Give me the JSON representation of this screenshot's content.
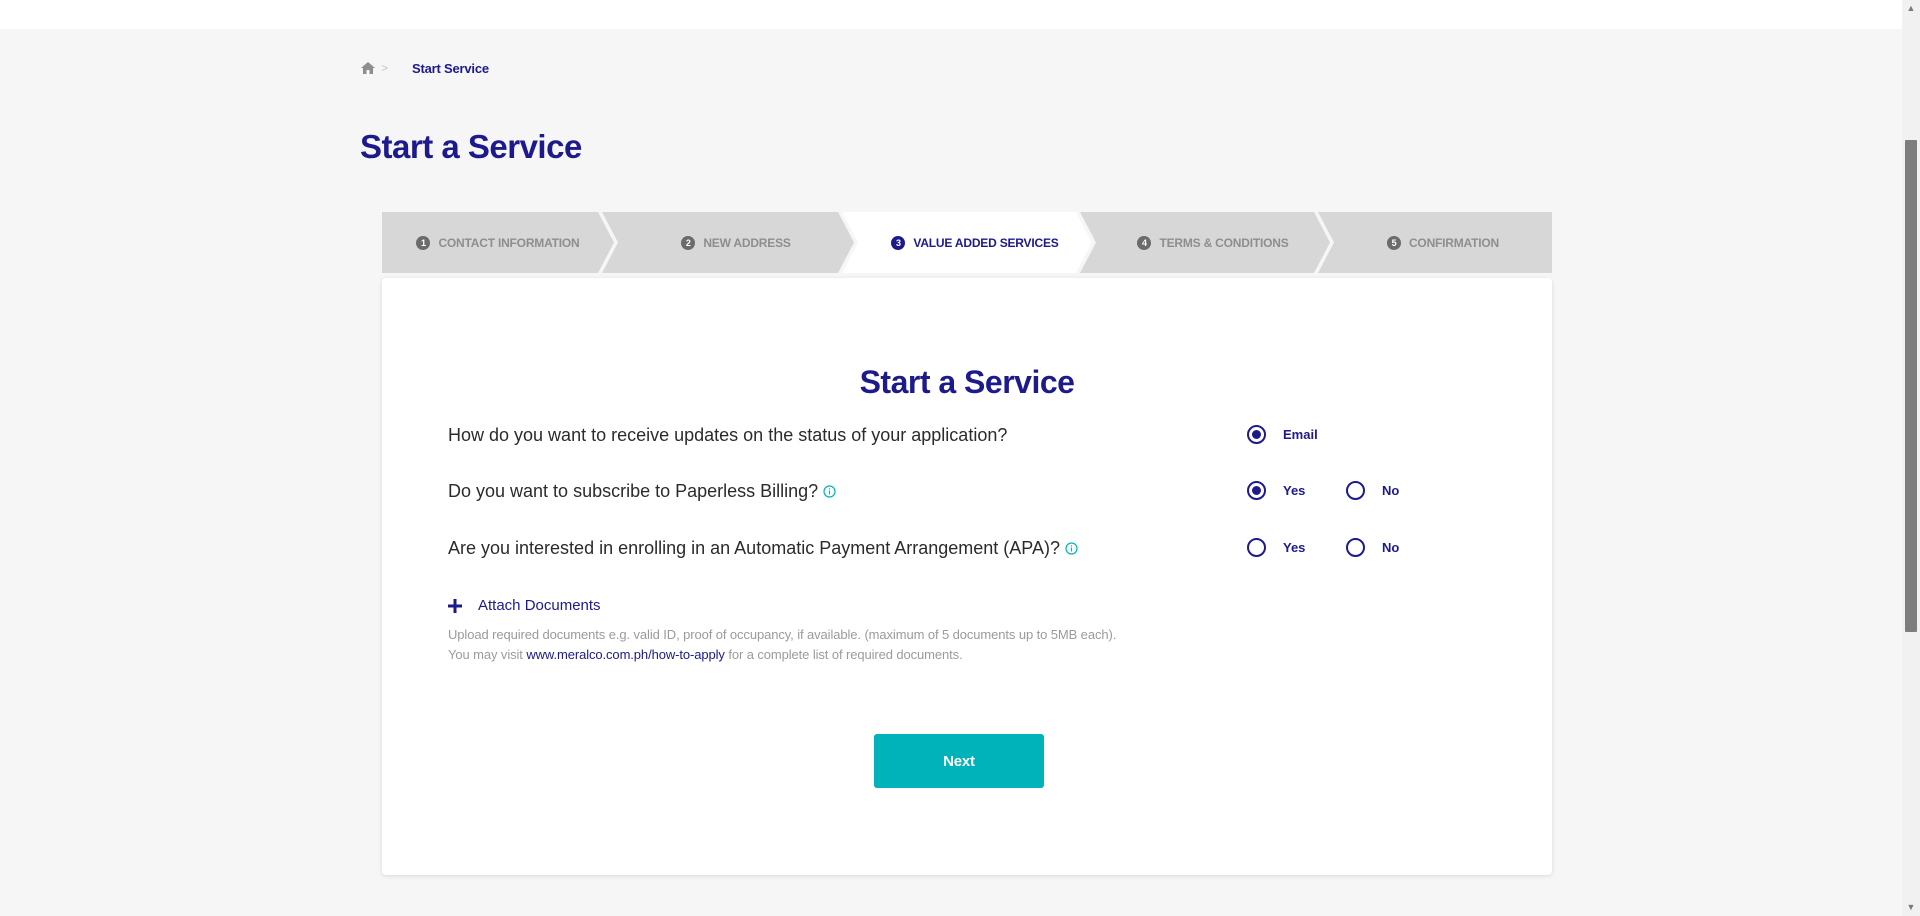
{
  "breadcrumb": {
    "home_icon": "home-icon",
    "separator": ">",
    "current": "Start Service"
  },
  "page_title": "Start a Service",
  "steps": [
    {
      "number": "1",
      "label": "CONTACT INFORMATION",
      "active": false
    },
    {
      "number": "2",
      "label": "NEW ADDRESS",
      "active": false
    },
    {
      "number": "3",
      "label": "VALUE ADDED SERVICES",
      "active": true
    },
    {
      "number": "4",
      "label": "TERMS & CONDITIONS",
      "active": false
    },
    {
      "number": "5",
      "label": "CONFIRMATION",
      "active": false
    }
  ],
  "form": {
    "title": "Start a Service",
    "questions": {
      "updates": {
        "text": "How do you want to receive updates on the status of your application?",
        "options": [
          {
            "label": "Email",
            "checked": true
          }
        ]
      },
      "paperless": {
        "text": "Do you want to subscribe to Paperless Billing?",
        "info_icon": "info-icon",
        "options": [
          {
            "label": "Yes",
            "checked": true
          },
          {
            "label": "No",
            "checked": false
          }
        ]
      },
      "apa": {
        "text": "Are you interested in enrolling in an Automatic Payment Arrangement (APA)?",
        "info_icon": "info-icon",
        "options": [
          {
            "label": "Yes",
            "checked": false
          },
          {
            "label": "No",
            "checked": false
          }
        ]
      }
    },
    "attach": {
      "label": "Attach Documents",
      "help_line1": "Upload required documents e.g. valid ID, proof of occupancy, if available. (maximum of 5 documents up to 5MB each).",
      "help_line2_prefix": "You may visit",
      "help_link": "www.meralco.com.ph/how-to-apply",
      "help_line2_suffix": "for a complete list of required documents."
    },
    "next_label": "Next"
  },
  "colors": {
    "brand_navy": "#1d1a8c",
    "accent_teal": "#00b3bb",
    "step_inactive": "#d7d7d7",
    "background": "#f6f6f6"
  }
}
